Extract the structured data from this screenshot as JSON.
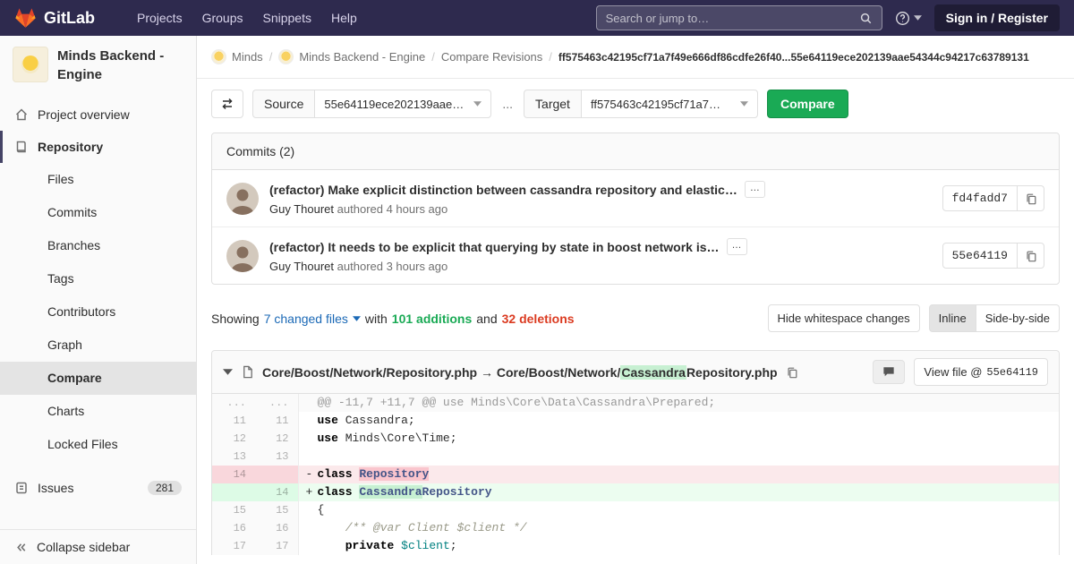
{
  "colors": {
    "navbar_bg": "#2e2a4e",
    "accent_green": "#1aaa55",
    "danger_red": "#db3b21",
    "link_blue": "#1b69b6",
    "addition_highlight": "#c7f0d2",
    "deletion_highlight": "#fac5cd"
  },
  "navbar": {
    "brand": "GitLab",
    "menu": [
      "Projects",
      "Groups",
      "Snippets",
      "Help"
    ],
    "search_placeholder": "Search or jump to…",
    "sign_in": "Sign in / Register"
  },
  "sidebar": {
    "project_title": "Minds Backend - Engine",
    "overview_label": "Project overview",
    "repository_label": "Repository",
    "repo_items": [
      "Files",
      "Commits",
      "Branches",
      "Tags",
      "Contributors",
      "Graph",
      "Compare",
      "Charts",
      "Locked Files"
    ],
    "issues_label": "Issues",
    "issues_count": "281",
    "collapse_label": "Collapse sidebar"
  },
  "breadcrumb": {
    "items": [
      "Minds",
      "Minds Backend - Engine",
      "Compare Revisions"
    ],
    "compare_range": "ff575463c42195cf71a7f49e666df86cdfe26f40...55e64119ece202139aae54344c94217c63789131"
  },
  "compare_form": {
    "source_label": "Source",
    "source_value": "55e64119ece202139aae…",
    "separator": "...",
    "target_label": "Target",
    "target_value": "ff575463c42195cf71a7…",
    "submit_label": "Compare"
  },
  "commits": {
    "header": "Commits (2)",
    "expand_label": "…",
    "items": [
      {
        "title": "(refactor) Make explicit distinction between cassandra repository and elastic…",
        "author": "Guy Thouret",
        "when": "authored 4 hours ago",
        "sha": "fd4fadd7"
      },
      {
        "title": "(refactor) It needs to be explicit that querying by state in boost network is…",
        "author": "Guy Thouret",
        "when": "authored 3 hours ago",
        "sha": "55e64119"
      }
    ]
  },
  "summary": {
    "showing": "Showing",
    "files": "7 changed files",
    "with_text": "with",
    "additions": "101 additions",
    "and_text": "and",
    "deletions": "32 deletions",
    "hide_whitespace": "Hide whitespace changes",
    "inline": "Inline",
    "side_by_side": "Side-by-side"
  },
  "diff": {
    "file_from": "Core/Boost/Network/Repository.php",
    "arrow": "→",
    "to_prefix": "Core/Boost/Network/",
    "to_highlight": "Cassandra",
    "to_suffix": "Repository.php",
    "view_file_label": "View file @",
    "view_file_sha": "55e64119",
    "lines": [
      {
        "type": "match",
        "old": "...",
        "new": "...",
        "sign": " ",
        "code": [
          {
            "t": "@@ -11,7 +11,7 @@ use Minds\\Core\\Data\\Cassandra\\Prepared;",
            "c": ""
          }
        ]
      },
      {
        "type": "ctx",
        "old": "11",
        "new": "11",
        "sign": " ",
        "code": [
          {
            "t": "use",
            "c": "k"
          },
          {
            "t": " Cassandra;",
            "c": ""
          }
        ]
      },
      {
        "type": "ctx",
        "old": "12",
        "new": "12",
        "sign": " ",
        "code": [
          {
            "t": "use",
            "c": "k"
          },
          {
            "t": " Minds\\Core\\Time;",
            "c": ""
          }
        ]
      },
      {
        "type": "ctx",
        "old": "13",
        "new": "13",
        "sign": " ",
        "code": []
      },
      {
        "type": "del",
        "old": "14",
        "new": "",
        "sign": "-",
        "code": [
          {
            "t": "class",
            "c": "k"
          },
          {
            "t": " ",
            "c": ""
          },
          {
            "t": "Repository",
            "c": "nc hl-del"
          }
        ]
      },
      {
        "type": "add",
        "old": "",
        "new": "14",
        "sign": "+",
        "code": [
          {
            "t": "class",
            "c": "k"
          },
          {
            "t": " ",
            "c": ""
          },
          {
            "t": "Cassandra",
            "c": "nc hl-add"
          },
          {
            "t": "Repository",
            "c": "nc"
          }
        ]
      },
      {
        "type": "ctx",
        "old": "15",
        "new": "15",
        "sign": " ",
        "code": [
          {
            "t": "{",
            "c": ""
          }
        ]
      },
      {
        "type": "ctx",
        "old": "16",
        "new": "16",
        "sign": " ",
        "code": [
          {
            "t": "    ",
            "c": ""
          },
          {
            "t": "/** @var Client $client */",
            "c": "c"
          }
        ]
      },
      {
        "type": "ctx",
        "old": "17",
        "new": "17",
        "sign": " ",
        "code": [
          {
            "t": "    ",
            "c": ""
          },
          {
            "t": "private",
            "c": "k"
          },
          {
            "t": " ",
            "c": ""
          },
          {
            "t": "$client",
            "c": "nv"
          },
          {
            "t": ";",
            "c": ""
          }
        ]
      }
    ]
  }
}
